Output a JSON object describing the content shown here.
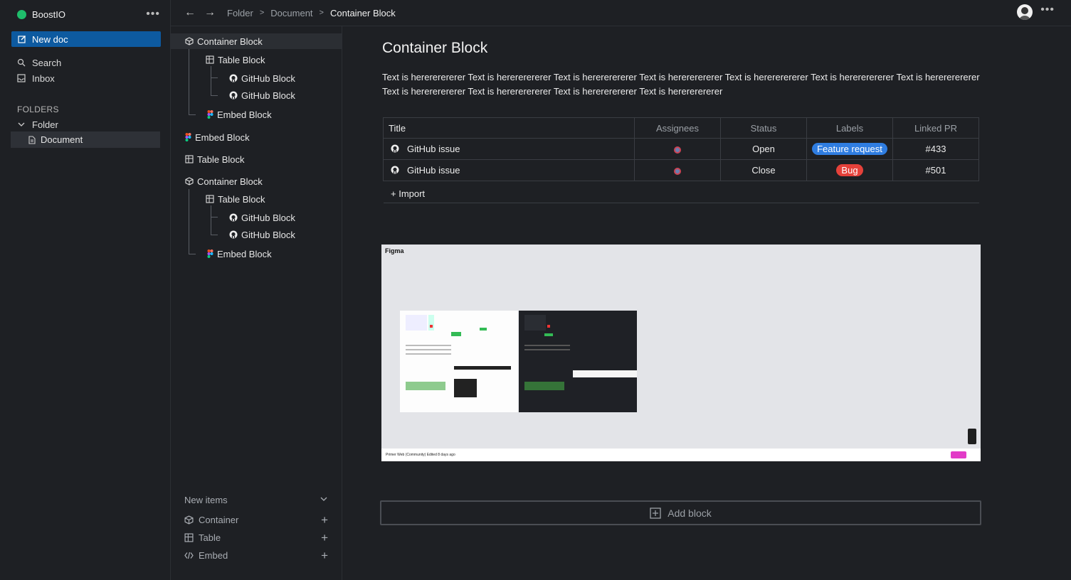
{
  "nav": {
    "team_name": "BoostIO",
    "new_doc": "New doc",
    "search": "Search",
    "inbox": "Inbox",
    "folders_label": "FOLDERS",
    "folder": "Folder",
    "document": "Document"
  },
  "breadcrumb": {
    "items": [
      "Folder",
      "Document"
    ],
    "current": "Container Block"
  },
  "tree": {
    "items": [
      "Container Block",
      "Table Block",
      "GitHub Block",
      "GitHub Block",
      "Embed Block",
      "Embed Block",
      "Table Block",
      "Container Block",
      "Table Block",
      "GitHub Block",
      "GitHub Block",
      "Embed Block"
    ],
    "new_items_label": "New items",
    "add_container": "Container",
    "add_table": "Table",
    "add_embed": "Embed"
  },
  "main": {
    "title": "Container Block",
    "paragraph": "Text is herererererer Text is herererererer Text is herererererer Text is herererererer Text is herererererer Text is herererererer Text is herererererer Text is herererererer Text is herererererer Text is herererererer Text is herererererer",
    "table": {
      "columns": [
        "Title",
        "Assignees",
        "Status",
        "Labels",
        "Linked PR"
      ],
      "rows": [
        {
          "title": "GitHub issue",
          "status": "Open",
          "label": "Feature request",
          "label_color": "#2f7de1",
          "pr": "#433"
        },
        {
          "title": "GitHub issue",
          "status": "Close",
          "label": "Bug",
          "label_color": "#e5413a",
          "pr": "#501"
        }
      ],
      "import": "+ Import"
    },
    "embed": {
      "tag": "Figma",
      "footer": "Primer Web (Community) Edited 8 days ago"
    },
    "add_block": "Add block"
  }
}
